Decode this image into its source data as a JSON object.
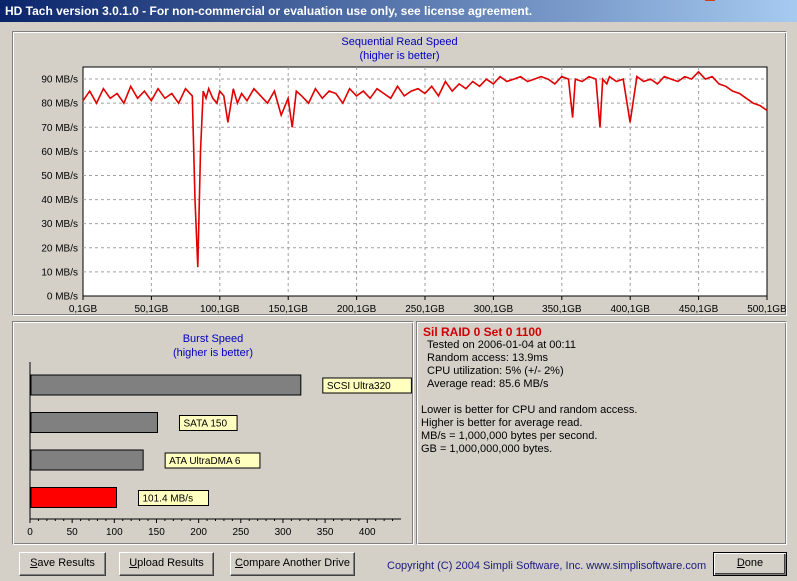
{
  "window": {
    "title": "HD Tach version 3.0.1.0  - For non-commercial or evaluation use only, see license agreement."
  },
  "sequential": {
    "title_line1": "Sequential Read Speed",
    "title_line2": "(higher is better)"
  },
  "burst": {
    "title_line1": "Burst Speed",
    "title_line2": "(higher is better)"
  },
  "chart_data": [
    {
      "type": "line",
      "title": "Sequential Read Speed",
      "subtitle": "(higher is better)",
      "xlabel": "",
      "ylabel": "",
      "x_tick_labels": [
        "0,1GB",
        "50,1GB",
        "100,1GB",
        "150,1GB",
        "200,1GB",
        "250,1GB",
        "300,1GB",
        "350,1GB",
        "400,1GB",
        "450,1GB",
        "500,1GB"
      ],
      "y_tick_labels": [
        "0 MB/s",
        "10 MB/s",
        "20 MB/s",
        "30 MB/s",
        "40 MB/s",
        "50 MB/s",
        "60 MB/s",
        "70 MB/s",
        "80 MB/s",
        "90 MB/s"
      ],
      "xlim": [
        0.1,
        500.1
      ],
      "ylim": [
        0,
        95
      ],
      "grid": true,
      "line_color": "#e00000",
      "series": [
        {
          "x": [
            0.1,
            5,
            10,
            15,
            20,
            25,
            30,
            35,
            40,
            45,
            50,
            55,
            60,
            65,
            70,
            75,
            80,
            82,
            84,
            86,
            88,
            90,
            92,
            95,
            98,
            100,
            103,
            106,
            110,
            113,
            116,
            120,
            125,
            130,
            135,
            140,
            145,
            150,
            153,
            156,
            160,
            165,
            170,
            175,
            180,
            185,
            190,
            195,
            200,
            205,
            210,
            215,
            220,
            225,
            230,
            235,
            240,
            245,
            250,
            255,
            260,
            265,
            270,
            275,
            280,
            285,
            290,
            295,
            300,
            305,
            310,
            315,
            320,
            325,
            330,
            335,
            340,
            345,
            350,
            355,
            358,
            360,
            365,
            370,
            375,
            378,
            380,
            383,
            385,
            390,
            395,
            400,
            405,
            410,
            415,
            420,
            425,
            430,
            435,
            440,
            445,
            450,
            455,
            460,
            465,
            470,
            475,
            480,
            485,
            490,
            495,
            500.1
          ],
          "y": [
            81,
            85,
            80,
            86,
            82,
            84,
            80,
            87,
            82,
            85,
            81,
            86,
            82,
            84,
            80,
            86,
            83,
            40,
            12,
            60,
            85,
            82,
            86,
            82,
            80,
            85,
            83,
            72,
            86,
            80,
            84,
            81,
            86,
            83,
            80,
            85,
            75,
            82,
            70,
            85,
            83,
            80,
            86,
            82,
            85,
            84,
            80,
            86,
            83,
            85,
            82,
            86,
            84,
            82,
            87,
            83,
            85,
            86,
            84,
            87,
            83,
            89,
            85,
            88,
            86,
            89,
            87,
            90,
            88,
            91,
            89,
            90,
            91,
            89,
            90,
            91,
            90,
            88,
            91,
            90,
            74,
            90,
            89,
            91,
            90,
            70,
            90,
            88,
            91,
            89,
            90,
            72,
            91,
            89,
            90,
            88,
            91,
            90,
            89,
            91,
            90,
            93,
            90,
            91,
            88,
            87,
            85,
            84,
            82,
            80,
            79,
            77
          ]
        }
      ]
    },
    {
      "type": "bar",
      "title": "Burst Speed",
      "subtitle": "(higher is better)",
      "orientation": "horizontal",
      "xlim": [
        0,
        440
      ],
      "x_tick_labels": [
        "0",
        "50",
        "100",
        "150",
        "200",
        "250",
        "300",
        "350",
        "400"
      ],
      "grid": false,
      "categories": [
        "SCSI Ultra320",
        "SATA 150",
        "ATA UltraDMA 6",
        "101.4 MB/s"
      ],
      "values": [
        320,
        150,
        133,
        101.4
      ],
      "colors": [
        "#808080",
        "#808080",
        "#808080",
        "#ff0000"
      ]
    }
  ],
  "info": {
    "header": "Sil RAID 0 Set 0 1100",
    "tested": "Tested on 2006-01-04 at 00:11",
    "random_access": "Random access: 13.9ms",
    "cpu": "CPU utilization: 5% (+/- 2%)",
    "average": "Average read: 85.6 MB/s",
    "note1": "Lower is better for CPU and random access.",
    "note2": "Higher is better for average read.",
    "note3": "MB/s = 1,000,000 bytes per second.",
    "note4": "GB = 1,000,000,000 bytes."
  },
  "buttons": {
    "save_prefix": "S",
    "save_rest": "ave Results",
    "upload_prefix": "U",
    "upload_rest": "pload Results",
    "compare_prefix": "C",
    "compare_rest": "ompare Another Drive",
    "done_prefix": "D",
    "done_rest": "one"
  },
  "footer": {
    "copyright": "Copyright (C) 2004 Simpli Software, Inc. www.simplisoftware.com"
  }
}
